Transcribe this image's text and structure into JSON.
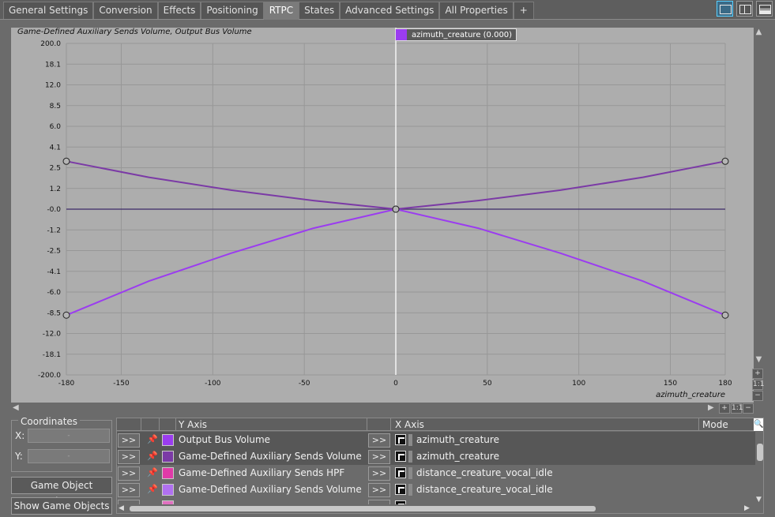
{
  "tabs": [
    "General Settings",
    "Conversion",
    "Effects",
    "Positioning",
    "RTPC",
    "States",
    "Advanced Settings",
    "All Properties",
    "+"
  ],
  "active_tab": "RTPC",
  "graph": {
    "title": "Game-Defined Auxiliary Sends Volume, Output Bus Volume",
    "cursor_label": "azimuth_creature (0.000)",
    "x_axis_name": "azimuth_creature"
  },
  "chart_data": {
    "type": "line",
    "x_ticks": [
      -180,
      -150,
      -100,
      -50,
      0,
      50,
      100,
      150,
      180
    ],
    "x_tick_labels": [
      "-180",
      "-150",
      "-100",
      "-50",
      "0",
      "50",
      "100",
      "150",
      "180"
    ],
    "y_tick_labels": [
      "200.0",
      "18.1",
      "12.0",
      "8.5",
      "6.0",
      "4.1",
      "2.5",
      "1.2",
      "-0.0",
      "-1.2",
      "-2.5",
      "-4.1",
      "-6.0",
      "-8.5",
      "-12.0",
      "-18.1",
      "-200.0"
    ],
    "xlim": [
      -180,
      180
    ],
    "series": [
      {
        "color": "#7b3aa6",
        "x": [
          -180,
          -135,
          -90,
          -45,
          0,
          45,
          90,
          135,
          180
        ],
        "y": [
          3.0,
          1.9,
          1.1,
          0.5,
          0.0,
          0.5,
          1.1,
          1.9,
          3.0
        ]
      },
      {
        "color": "#9b3cf0",
        "x": [
          -180,
          -135,
          -90,
          -45,
          0,
          45,
          90,
          135,
          180
        ],
        "y": [
          -8.9,
          -5.0,
          -2.7,
          -1.1,
          0.0,
          -1.1,
          -2.7,
          -5.0,
          -8.9
        ]
      }
    ],
    "control_points_x": [
      -180,
      0,
      180
    ],
    "cursor_x": 0,
    "grid": true
  },
  "coordinates": {
    "title": "Coordinates",
    "x_label": "X:",
    "y_label": "Y:",
    "x_value": "-",
    "y_value": "-"
  },
  "buttons": {
    "explorer": "Game Object Explorer...",
    "show_objects": "Show Game Objects"
  },
  "table": {
    "headers": {
      "y_axis": "Y Axis",
      "x_axis": "X Axis",
      "mode": "Mode"
    },
    "rows": [
      {
        "y": "Output Bus Volume",
        "x": "azimuth_creature",
        "color": "#9b3cf0",
        "selected": true
      },
      {
        "y": "Game-Defined Auxiliary Sends Volume",
        "x": "azimuth_creature",
        "color": "#7b3aa6",
        "selected": true
      },
      {
        "y": "Game-Defined Auxiliary Sends HPF",
        "x": "distance_creature_vocal_idle",
        "color": "#e03aa8",
        "selected": false
      },
      {
        "y": "Game-Defined Auxiliary Sends Volume",
        "x": "distance_creature_vocal_idle",
        "color": "#b070f0",
        "selected": false
      }
    ],
    "arrow_label": ">>"
  }
}
